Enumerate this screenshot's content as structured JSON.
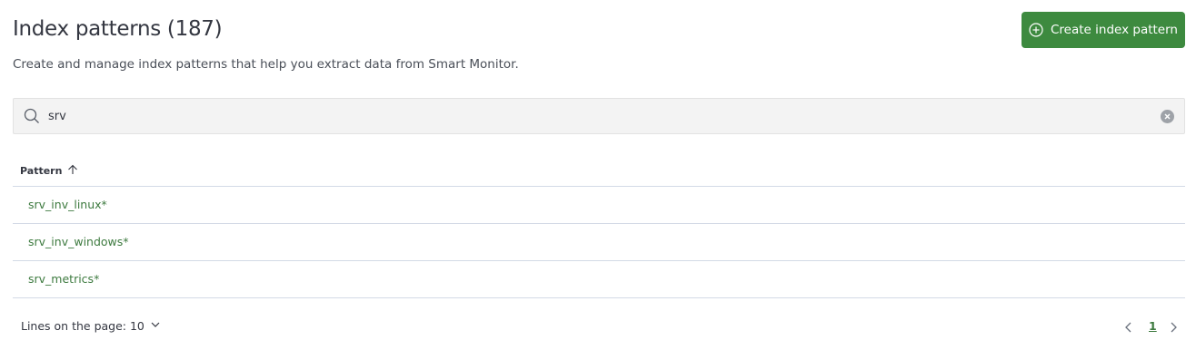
{
  "header": {
    "title": "Index patterns (187)",
    "subtitle": "Create and manage index patterns that help you extract data from Smart Monitor.",
    "create_button_label": "Create index pattern",
    "create_button_icon": "plus-circle-icon"
  },
  "search": {
    "value": "srv",
    "icon": "search-icon",
    "clear_icon": "clear-icon"
  },
  "table": {
    "column_header": "Pattern",
    "sort_direction": "ascending",
    "rows": [
      {
        "pattern": "srv_inv_linux*"
      },
      {
        "pattern": "srv_inv_windows*"
      },
      {
        "pattern": "srv_metrics*"
      }
    ]
  },
  "footer": {
    "lines_label": "Lines on the page: 10",
    "current_page": "1"
  },
  "colors": {
    "accent": "#3d8a3f",
    "link": "#3d7a3f",
    "search_bg": "#f3f3f3"
  }
}
